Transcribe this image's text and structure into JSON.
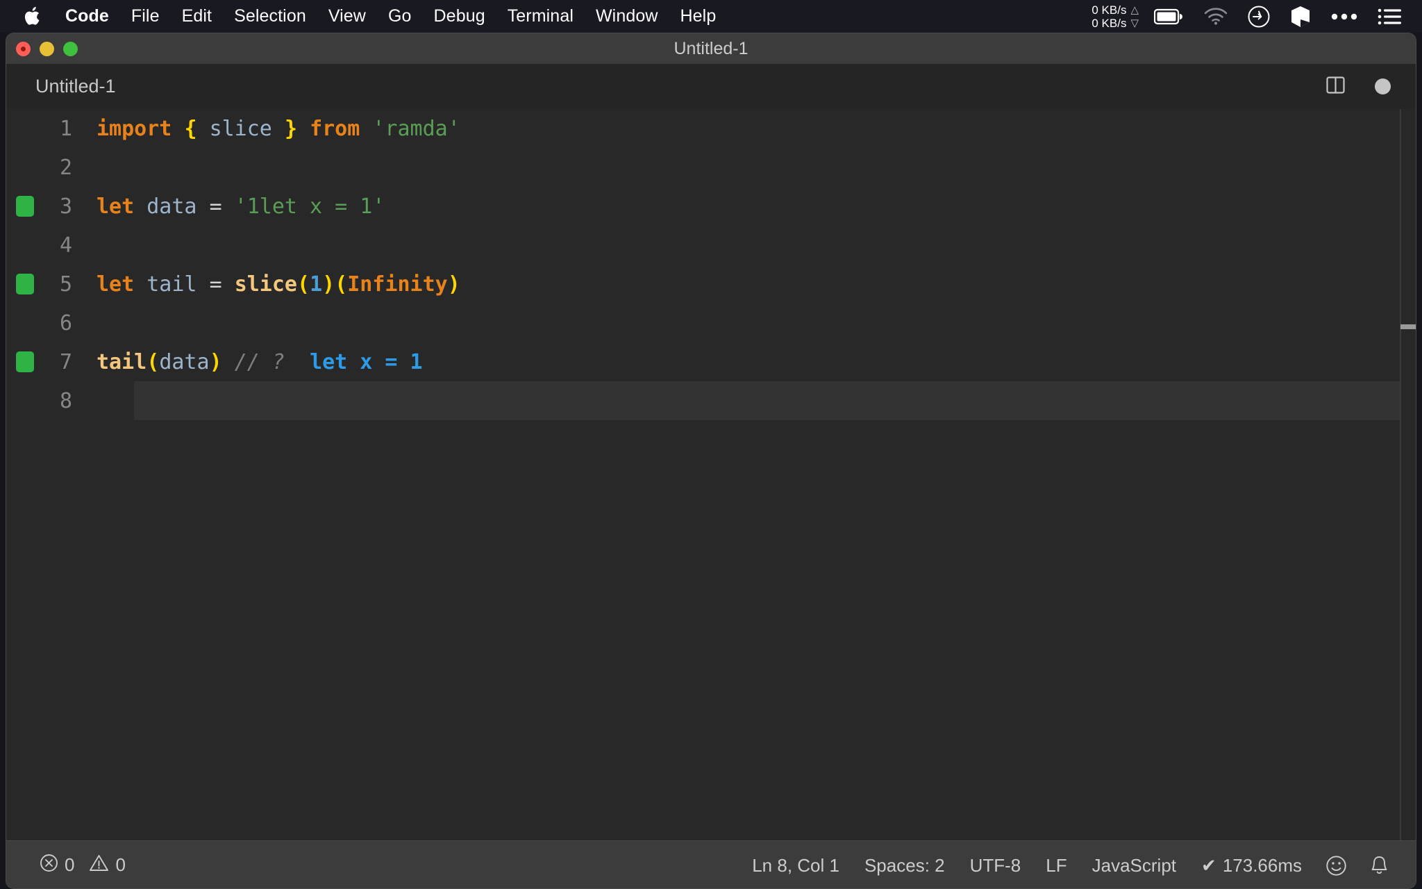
{
  "menubar": {
    "apple_icon": "apple-logo",
    "items": [
      {
        "label": "Code",
        "bold": true
      },
      {
        "label": "File",
        "bold": false
      },
      {
        "label": "Edit",
        "bold": false
      },
      {
        "label": "Selection",
        "bold": false
      },
      {
        "label": "View",
        "bold": false
      },
      {
        "label": "Go",
        "bold": false
      },
      {
        "label": "Debug",
        "bold": false
      },
      {
        "label": "Terminal",
        "bold": false
      },
      {
        "label": "Window",
        "bold": false
      },
      {
        "label": "Help",
        "bold": false
      }
    ],
    "status": {
      "net_up": "0 KB/s",
      "net_down": "0 KB/s",
      "up_arrow": "△",
      "down_arrow": "▽",
      "icons": [
        "battery-icon",
        "wifi-icon",
        "clock-icon",
        "cube-icon",
        "ellipsis-icon",
        "list-icon"
      ]
    }
  },
  "window": {
    "title": "Untitled-1",
    "traffic_lights": [
      "close-button",
      "minimize-button",
      "maximize-button"
    ]
  },
  "tabbar": {
    "tab_label": "Untitled-1",
    "split_editor_icon": "split-editor-icon",
    "dirty_indicator": "unsaved-changes-dot"
  },
  "editor": {
    "language": "JavaScript",
    "current_line": 8,
    "lines": [
      {
        "number": "1",
        "decoration": false,
        "current": false,
        "tokens": [
          {
            "t": "import",
            "c": "kw"
          },
          {
            "t": " ",
            "c": "op"
          },
          {
            "t": "{",
            "c": "brace"
          },
          {
            "t": " ",
            "c": "op"
          },
          {
            "t": "slice",
            "c": "ident"
          },
          {
            "t": " ",
            "c": "op"
          },
          {
            "t": "}",
            "c": "brace"
          },
          {
            "t": " ",
            "c": "op"
          },
          {
            "t": "from",
            "c": "kw"
          },
          {
            "t": " ",
            "c": "op"
          },
          {
            "t": "'ramda'",
            "c": "str"
          }
        ]
      },
      {
        "number": "2",
        "decoration": false,
        "current": false,
        "tokens": []
      },
      {
        "number": "3",
        "decoration": true,
        "current": false,
        "tokens": [
          {
            "t": "let",
            "c": "kw"
          },
          {
            "t": " ",
            "c": "op"
          },
          {
            "t": "data",
            "c": "ident"
          },
          {
            "t": " ",
            "c": "op"
          },
          {
            "t": "=",
            "c": "op"
          },
          {
            "t": " ",
            "c": "op"
          },
          {
            "t": "'1let x = 1'",
            "c": "str"
          }
        ]
      },
      {
        "number": "4",
        "decoration": false,
        "current": false,
        "tokens": []
      },
      {
        "number": "5",
        "decoration": true,
        "current": false,
        "tokens": [
          {
            "t": "let",
            "c": "kw"
          },
          {
            "t": " ",
            "c": "op"
          },
          {
            "t": "tail",
            "c": "ident"
          },
          {
            "t": " ",
            "c": "op"
          },
          {
            "t": "=",
            "c": "op"
          },
          {
            "t": " ",
            "c": "op"
          },
          {
            "t": "slice",
            "c": "fn"
          },
          {
            "t": "(",
            "c": "brace"
          },
          {
            "t": "1",
            "c": "num"
          },
          {
            "t": ")",
            "c": "brace"
          },
          {
            "t": "(",
            "c": "brace"
          },
          {
            "t": "Infinity",
            "c": "const"
          },
          {
            "t": ")",
            "c": "brace"
          }
        ]
      },
      {
        "number": "6",
        "decoration": false,
        "current": false,
        "tokens": []
      },
      {
        "number": "7",
        "decoration": true,
        "current": false,
        "tokens": [
          {
            "t": "tail",
            "c": "fn"
          },
          {
            "t": "(",
            "c": "brace"
          },
          {
            "t": "data",
            "c": "ident"
          },
          {
            "t": ")",
            "c": "brace"
          },
          {
            "t": " ",
            "c": "op"
          },
          {
            "t": "// ?",
            "c": "comment"
          },
          {
            "t": "  ",
            "c": "op"
          },
          {
            "t": "let x = 1",
            "c": "quokka"
          }
        ]
      },
      {
        "number": "8",
        "decoration": false,
        "current": true,
        "tokens": []
      }
    ]
  },
  "statusbar": {
    "errors_icon": "error-circle-icon",
    "errors_count": "0",
    "warnings_icon": "warning-triangle-icon",
    "warnings_count": "0",
    "cursor_position": "Ln 8, Col 1",
    "indentation": "Spaces: 2",
    "encoding": "UTF-8",
    "line_ending": "LF",
    "language_mode": "JavaScript",
    "quokka_check": "✔",
    "quokka_time": "173.66ms",
    "feedback_icon": "smiley-icon",
    "notifications_icon": "bell-icon"
  },
  "colors": {
    "menubar_bg": "#191922",
    "titlebar_bg": "#3c3c3c",
    "editor_bg": "#282828",
    "statusbar_bg": "#3c3c3c",
    "accent_green": "#2fb344",
    "quokka_blue": "#2e9be6",
    "keyword_orange": "#e8821b",
    "string_green": "#5a9e56",
    "brace_yellow": "#ffd500"
  }
}
